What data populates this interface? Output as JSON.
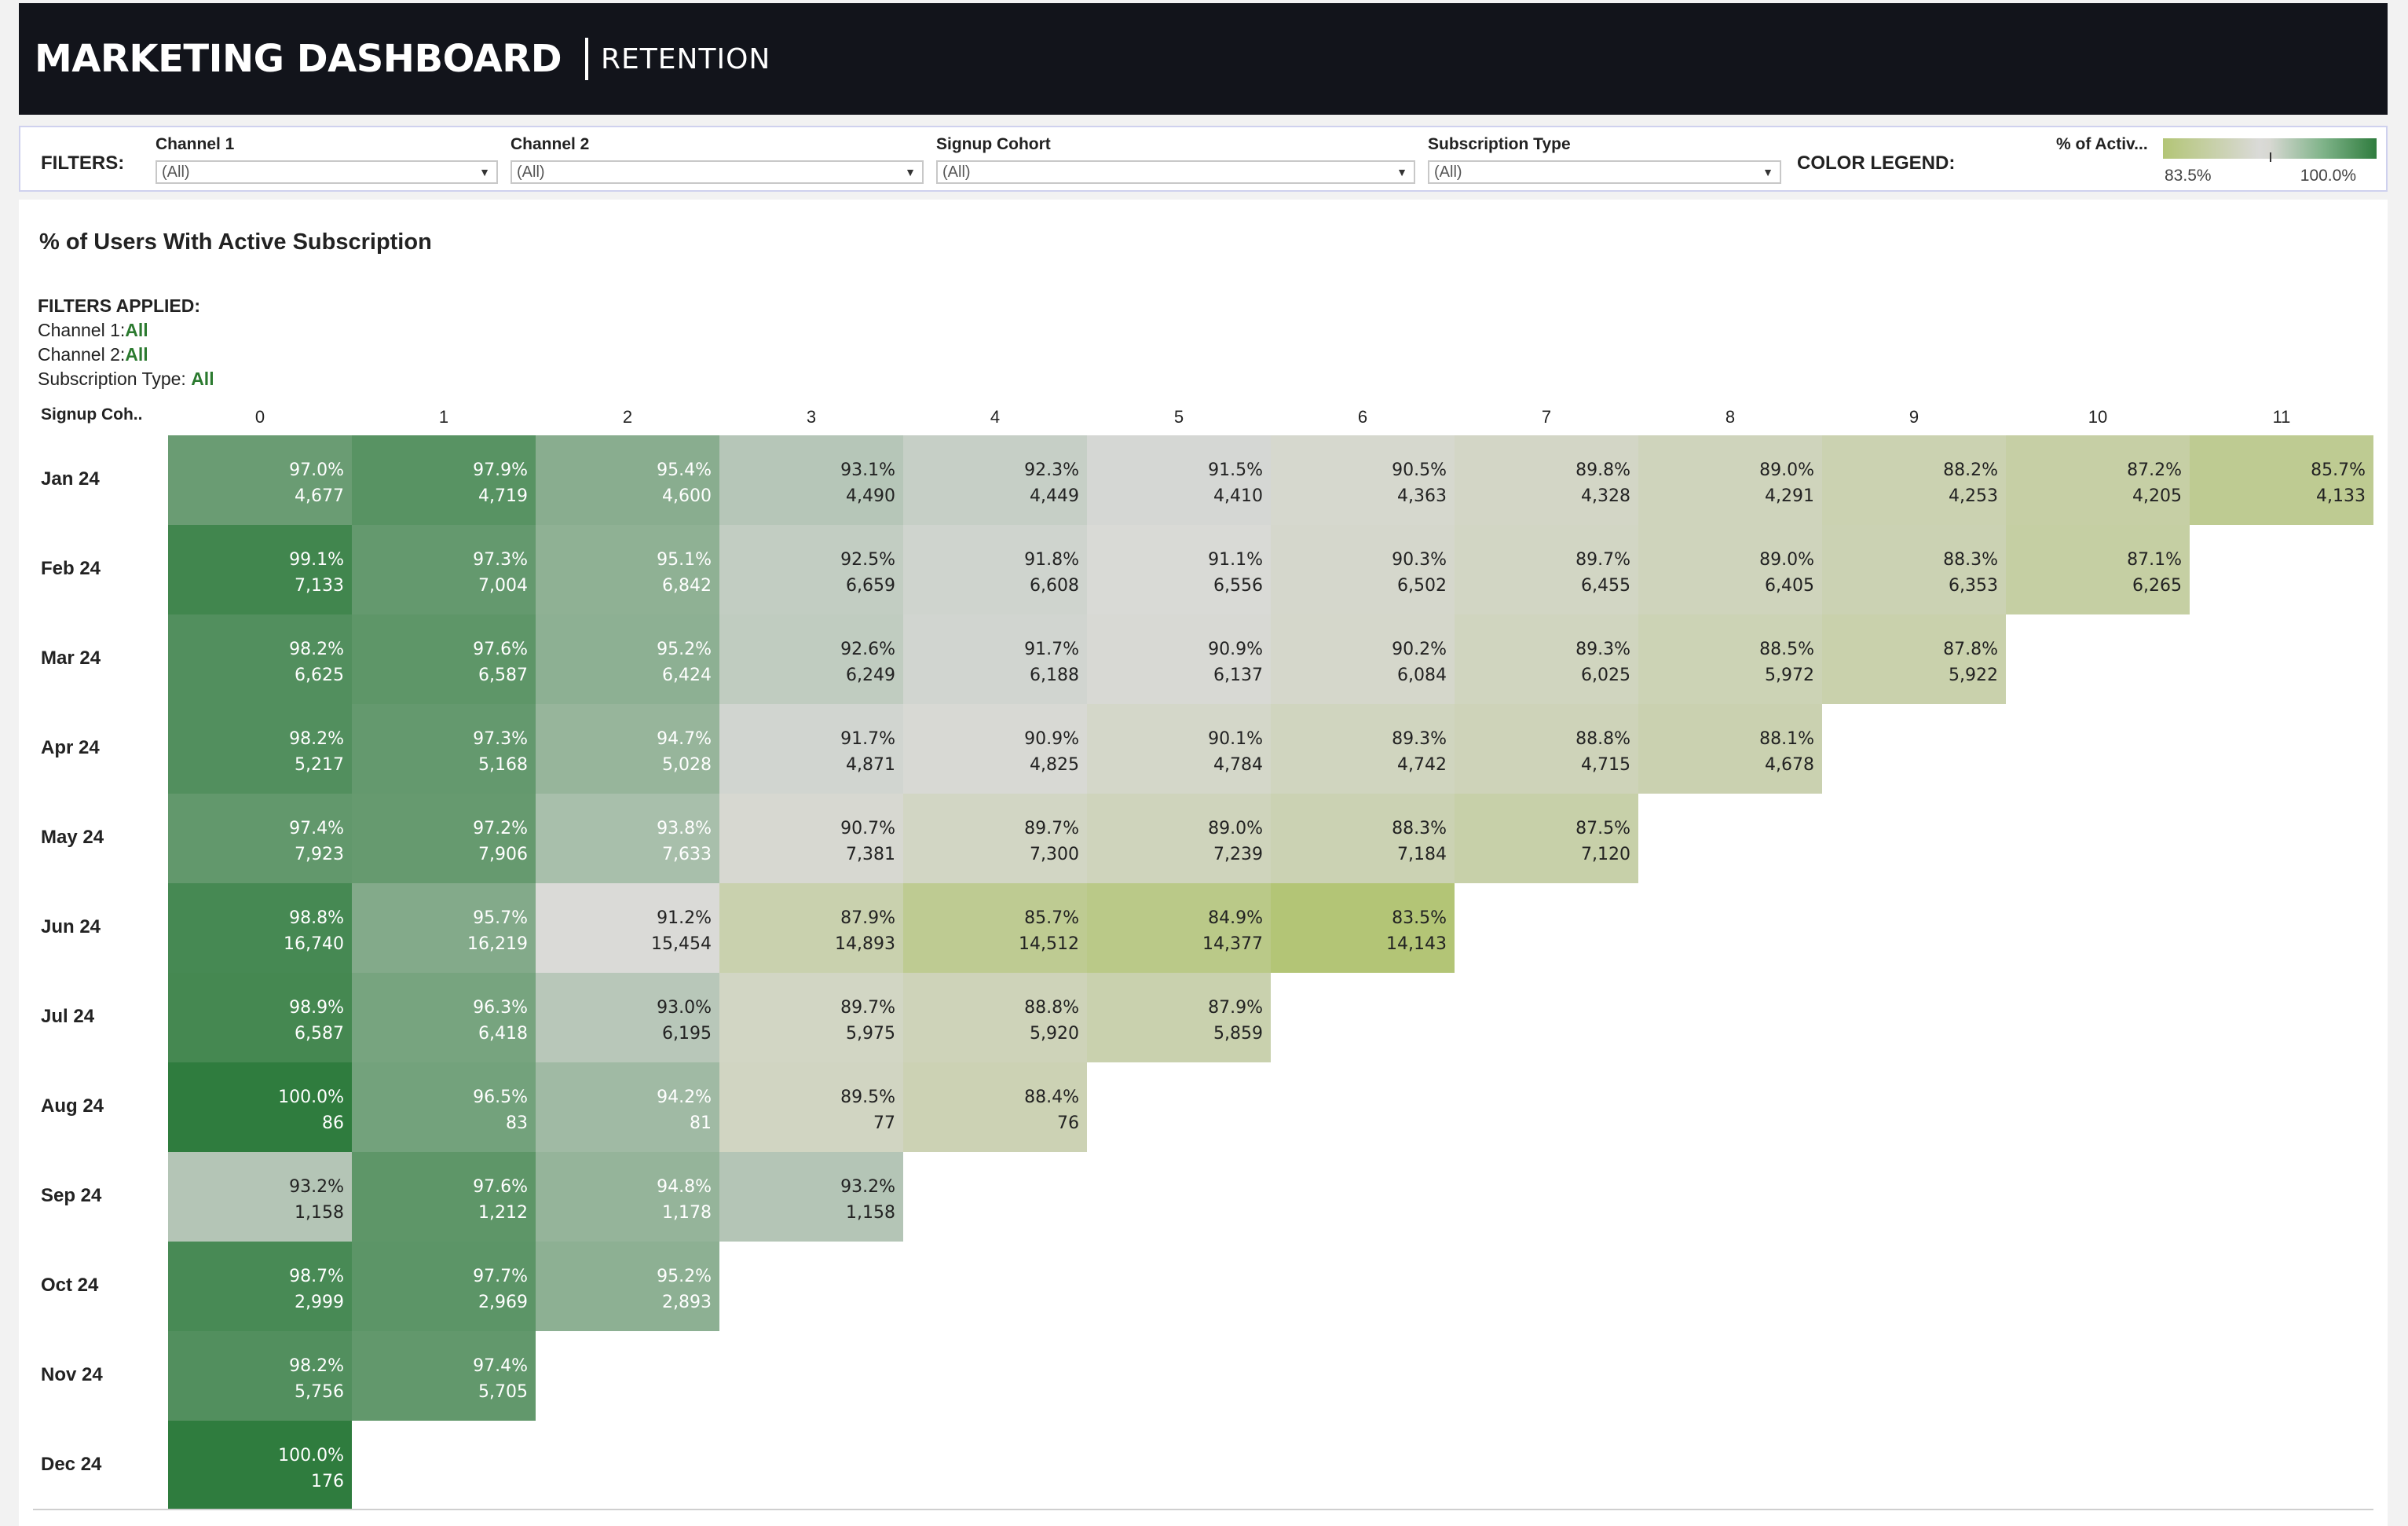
{
  "header": {
    "title": "MARKETING DASHBOARD",
    "subtitle": "RETENTION"
  },
  "filters": {
    "label": "FILTERS:",
    "items": [
      {
        "label": "Channel 1",
        "value": "(All)"
      },
      {
        "label": "Channel 2",
        "value": "(All)"
      },
      {
        "label": "Signup Cohort",
        "value": "(All)"
      },
      {
        "label": "Subscription Type",
        "value": "(All)"
      }
    ]
  },
  "legend": {
    "label": "COLOR LEGEND:",
    "title": "% of Activ...",
    "min": "83.5%",
    "max": "100.0%",
    "colors": {
      "low": "#b3c576",
      "mid": "#dadad8",
      "high": "#2f7c3e"
    }
  },
  "main": {
    "title": "% of Users With Active Subscription",
    "applied": {
      "heading": "FILTERS APPLIED:",
      "channel1_label": "Channel 1:",
      "channel1_value": "All",
      "channel2_label": "Channel 2:",
      "channel2_value": "All",
      "subtype_label": "Subscription Type: ",
      "subtype_value": "All"
    },
    "row_header": "Signup Coh.."
  },
  "chart_data": {
    "type": "heatmap",
    "columns": [
      "0",
      "1",
      "2",
      "3",
      "4",
      "5",
      "6",
      "7",
      "8",
      "9",
      "10",
      "11"
    ],
    "rows": [
      {
        "cohort": "Jan 24",
        "pct": [
          "97.0%",
          "97.9%",
          "95.4%",
          "93.1%",
          "92.3%",
          "91.5%",
          "90.5%",
          "89.8%",
          "89.0%",
          "88.2%",
          "87.2%",
          "85.7%"
        ],
        "users": [
          "4,677",
          "4,719",
          "4,600",
          "4,490",
          "4,449",
          "4,410",
          "4,363",
          "4,328",
          "4,291",
          "4,253",
          "4,205",
          "4,133"
        ]
      },
      {
        "cohort": "Feb 24",
        "pct": [
          "99.1%",
          "97.3%",
          "95.1%",
          "92.5%",
          "91.8%",
          "91.1%",
          "90.3%",
          "89.7%",
          "89.0%",
          "88.3%",
          "87.1%"
        ],
        "users": [
          "7,133",
          "7,004",
          "6,842",
          "6,659",
          "6,608",
          "6,556",
          "6,502",
          "6,455",
          "6,405",
          "6,353",
          "6,265"
        ]
      },
      {
        "cohort": "Mar 24",
        "pct": [
          "98.2%",
          "97.6%",
          "95.2%",
          "92.6%",
          "91.7%",
          "90.9%",
          "90.2%",
          "89.3%",
          "88.5%",
          "87.8%"
        ],
        "users": [
          "6,625",
          "6,587",
          "6,424",
          "6,249",
          "6,188",
          "6,137",
          "6,084",
          "6,025",
          "5,972",
          "5,922"
        ]
      },
      {
        "cohort": "Apr 24",
        "pct": [
          "98.2%",
          "97.3%",
          "94.7%",
          "91.7%",
          "90.9%",
          "90.1%",
          "89.3%",
          "88.8%",
          "88.1%"
        ],
        "users": [
          "5,217",
          "5,168",
          "5,028",
          "4,871",
          "4,825",
          "4,784",
          "4,742",
          "4,715",
          "4,678"
        ]
      },
      {
        "cohort": "May 24",
        "pct": [
          "97.4%",
          "97.2%",
          "93.8%",
          "90.7%",
          "89.7%",
          "89.0%",
          "88.3%",
          "87.5%"
        ],
        "users": [
          "7,923",
          "7,906",
          "7,633",
          "7,381",
          "7,300",
          "7,239",
          "7,184",
          "7,120"
        ]
      },
      {
        "cohort": "Jun 24",
        "pct": [
          "98.8%",
          "95.7%",
          "91.2%",
          "87.9%",
          "85.7%",
          "84.9%",
          "83.5%"
        ],
        "users": [
          "16,740",
          "16,219",
          "15,454",
          "14,893",
          "14,512",
          "14,377",
          "14,143"
        ]
      },
      {
        "cohort": "Jul 24",
        "pct": [
          "98.9%",
          "96.3%",
          "93.0%",
          "89.7%",
          "88.8%",
          "87.9%"
        ],
        "users": [
          "6,587",
          "6,418",
          "6,195",
          "5,975",
          "5,920",
          "5,859"
        ]
      },
      {
        "cohort": "Aug 24",
        "pct": [
          "100.0%",
          "96.5%",
          "94.2%",
          "89.5%",
          "88.4%"
        ],
        "users": [
          "86",
          "83",
          "81",
          "77",
          "76"
        ]
      },
      {
        "cohort": "Sep 24",
        "pct": [
          "93.2%",
          "97.6%",
          "94.8%",
          "93.2%"
        ],
        "users": [
          "1,158",
          "1,212",
          "1,178",
          "1,158"
        ]
      },
      {
        "cohort": "Oct 24",
        "pct": [
          "98.7%",
          "97.7%",
          "95.2%"
        ],
        "users": [
          "2,999",
          "2,969",
          "2,893"
        ]
      },
      {
        "cohort": "Nov 24",
        "pct": [
          "98.2%",
          "97.4%"
        ],
        "users": [
          "5,756",
          "5,705"
        ]
      },
      {
        "cohort": "Dec 24",
        "pct": [
          "100.0%"
        ],
        "users": [
          "176"
        ]
      }
    ],
    "color_scale": {
      "min": 83.5,
      "max": 100.0
    }
  }
}
